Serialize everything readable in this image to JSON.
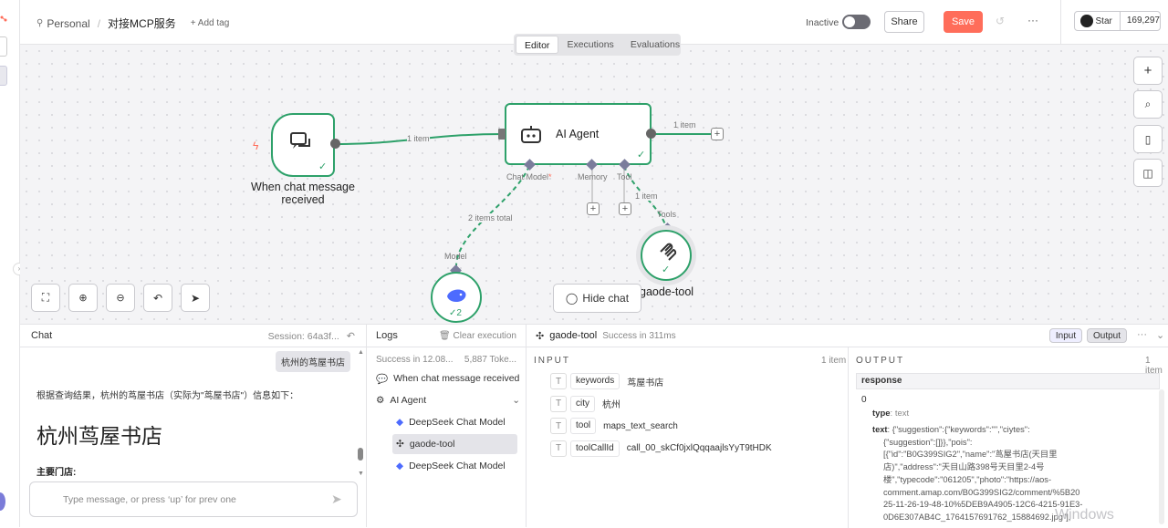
{
  "header": {
    "project": "Personal",
    "workflow_name": "对接MCP服务",
    "add_tag": "+ Add tag",
    "active_label": "Inactive",
    "share": "Share",
    "save": "Save",
    "more": "···",
    "github_star": "Star",
    "github_count": "169,297"
  },
  "tabs": [
    "Editor",
    "Executions",
    "Evaluations"
  ],
  "nodes": {
    "trigger": {
      "title": "When chat message received"
    },
    "agent": {
      "title": "AI Agent",
      "chat_model": "Chat Model",
      "chat_model_req": "*",
      "memory": "Memory",
      "tool": "Tool"
    },
    "model": {
      "port": "Model",
      "count": "2"
    },
    "tool": {
      "title": "gaode-tool",
      "port": "Tools"
    }
  },
  "edges": {
    "trigger_to_agent": "1 item",
    "agent_out": "1 item",
    "model_edge": "2 items total",
    "tool_edge": "1 item"
  },
  "canvas": {
    "hide_chat": "Hide chat"
  },
  "chat": {
    "title": "Chat",
    "session": "Session: 64a3f...",
    "user_msg": "杭州的茑屋书店",
    "reply_intro": "根据查询结果，杭州的茑屋书店（实际为\"茑屋书店\"）信息如下：",
    "reply_heading": "杭州茑屋书店",
    "reply_sub": "主要门店:",
    "input_placeholder": "Type message, or press ‘up’ for prev one"
  },
  "logs": {
    "title": "Logs",
    "clear": "Clear execution",
    "status": "Success in 12.08...",
    "tokens": "5,887 Toke...",
    "items": [
      {
        "label": "When chat message received",
        "icon": "chat-icon",
        "indent": 0
      },
      {
        "label": "AI Agent",
        "icon": "robot-icon",
        "indent": 0
      },
      {
        "label": "DeepSeek Chat Model",
        "icon": "deepseek-icon",
        "indent": 1
      },
      {
        "label": "gaode-tool",
        "icon": "tool-icon",
        "indent": 1
      },
      {
        "label": "DeepSeek Chat Model",
        "icon": "deepseek-icon",
        "indent": 1
      }
    ]
  },
  "detail": {
    "node": "gaode-tool",
    "status": "Success in 311ms",
    "input_btn": "Input",
    "output_btn": "Output",
    "more": "···",
    "input_title": "INPUT",
    "input_count": "1 item",
    "input_fields": [
      {
        "key": "keywords",
        "value": "茑屋书店"
      },
      {
        "key": "city",
        "value": "杭州"
      },
      {
        "key": "tool",
        "value": "maps_text_search"
      },
      {
        "key": "toolCallId",
        "value": "call_00_skCf0jxlQqqaajlsYyT9tHDK"
      }
    ],
    "output_title": "OUTPUT",
    "output_count": "1 item",
    "output_field": "response",
    "output_index": "0",
    "type_key": "type",
    "type_val": ": text",
    "text_key": "text",
    "text_lines": [
      ": {\"suggestion\":{\"keywords\":\"\",\"ciytes\":",
      "{\"suggestion\":[]}},\"pois\":",
      "[{\"id\":\"B0G399SIG2\",\"name\":\"茑屋书店(天目里",
      "店)\",\"address\":\"天目山路398号天目里2-4号",
      "楼\",\"typecode\":\"061205\",\"photo\":\"https://aos-",
      "comment.amap.com/B0G399SIG2/comment/%5B20",
      "25-11-26-19-48-10%5DEB9A4905-12C6-4215-91E3-",
      "0D6E307AB4C_1764157691762_15884692.jpg\"],"
    ]
  },
  "watermark": "Windows",
  "colors": {
    "accent": "#ff6d5a",
    "success": "#2ea16a",
    "port": "#7b7c9c"
  }
}
